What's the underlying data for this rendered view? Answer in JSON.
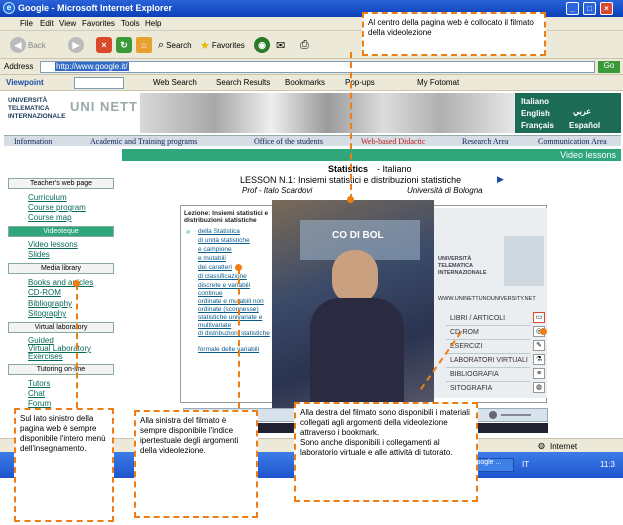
{
  "window": {
    "title": "Google - Microsoft Internet Explorer"
  },
  "menu": [
    "File",
    "Edit",
    "View",
    "Favorites",
    "Tools",
    "Help"
  ],
  "toolbar": {
    "back": "Back",
    "search": "Search",
    "favorites": "Favorites"
  },
  "address": {
    "label": "Address",
    "url": "http://www.google.it/",
    "go": "Go"
  },
  "links": {
    "viewpoint": "Viewpoint",
    "web_search": "Web Search",
    "search_results": "Search Results",
    "bookmarks": "Bookmarks",
    "popups": "Pop-ups",
    "fotomat": "My Fotomat"
  },
  "banner": {
    "logo_left": "UNIVERSITÀ\nTELEMATICA\nINTERNAZIONALE",
    "logo_mark": "UNI NETT",
    "langs": [
      "Italiano",
      "عربي",
      "English",
      "Français",
      "Español"
    ]
  },
  "nav": [
    "Information",
    "Academic and Training programs",
    "Office of the students",
    "Web-based Didactic",
    "Research Area",
    "Communication Area"
  ],
  "section": "Video lessons",
  "sidebar": {
    "teacher_header": "Teacher's web page",
    "teacher_links": [
      "Curriculum",
      "Course program",
      "Course map"
    ],
    "videoteque": "Videoteque",
    "video_links": [
      "Video lessons",
      "Slides"
    ],
    "media_header": "Media library",
    "media_links": [
      "Books and articles",
      "CD-ROM",
      "Bibliography",
      "Sitography"
    ],
    "virtual_header": "Virtual laboratory",
    "virtual_links": [
      "Guided",
      "Virtual Laboratory",
      "Exercises"
    ],
    "tutoring_header": "Tutoring on-line",
    "tutoring_links": [
      "Tutors",
      "Chat",
      "Forum"
    ]
  },
  "lesson": {
    "title": "Statistics",
    "lang": "- Italiano",
    "subtitle": "LESSON N.1: Insiemi statistici e distribuzioni statistiche",
    "prof": "Prof - Italo Scardovi",
    "univ": "Università di Bologna"
  },
  "index": {
    "header": "Lezione: Insiemi statistici e distribuzioni statistiche",
    "items": [
      "della Statistica",
      "di unità statistiche",
      "e campione",
      "e mutabili",
      "dei caratteri",
      "di classificazione",
      "discrete e variabili continue",
      "ordinate e mutabili non ordinate (sconnesse)",
      "statistiche univariate e multivariate",
      "di distribuzioni statistiche",
      "formale delle variabili"
    ]
  },
  "right_panel": {
    "logo": "UNIVERSITÀ TELEMATICA INTERNAZIONALE",
    "url": "WWW.UNINETTUNOUNIVERSITY.NET",
    "items": [
      "LIBRI / ARTICOLI",
      "CD-ROM",
      "ESERCIZI",
      "LABORATORI VIRTUALI",
      "BIBLIOGRAFIA",
      "SITOGRAFIA"
    ]
  },
  "video": {
    "label": "CO DI BOL"
  },
  "status": {
    "zone": "Internet"
  },
  "taskbar": {
    "task": "Google ...",
    "lang": "IT",
    "clock": "11:3"
  },
  "callouts": {
    "top": "Al centro della pagina web è collocato il filmato della videolezione",
    "left": "Sul lato sinistro della pagina web è sempre disponibile l'intero menù dell'insegnamento.",
    "middle": "Alla sinistra del filmato è sempre disponibile l'indice ipertestuale degli argomenti della videolezione.",
    "right": "Alla destra del filmato sono disponibili i materiali collegati agli argomenti della videolezione attraverso i bookmark.\nSono anche disponibili i collegamenti al laboratorio virtuale e alle attività di tutorato."
  }
}
